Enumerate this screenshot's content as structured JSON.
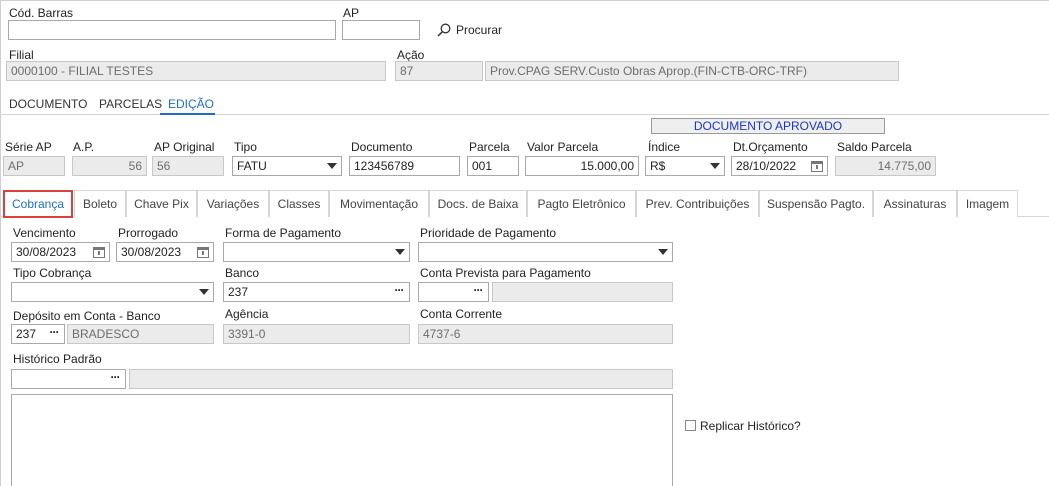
{
  "header": {
    "cod_barras_label": "Cód. Barras",
    "cod_barras_value": "",
    "ap_label": "AP",
    "ap_value": "",
    "search_label": "Procurar",
    "filial_label": "Filial",
    "filial_value": "0000100 - FILIAL TESTES",
    "acao_label": "Ação",
    "acao_code": "87",
    "acao_desc": "Prov.CPAG SERV.Custo Obras Aprop.(FIN-CTB-ORC-TRF)"
  },
  "top_tabs": [
    "DOCUMENTO",
    "PARCELAS",
    "EDIÇÃO"
  ],
  "status_badge": "DOCUMENTO APROVADO",
  "parcela": {
    "serie_ap_label": "Série AP",
    "serie_ap_value": "AP",
    "ap_num_label": "A.P.",
    "ap_num_value": "56",
    "ap_original_label": "AP Original",
    "ap_original_value": "56",
    "tipo_label": "Tipo",
    "tipo_value": "FATU",
    "documento_label": "Documento",
    "documento_value": "123456789",
    "parcela_label": "Parcela",
    "parcela_value": "001",
    "valor_label": "Valor Parcela",
    "valor_value": "15.000,00",
    "indice_label": "Índice",
    "indice_value": "R$",
    "dt_orcamento_label": "Dt.Orçamento",
    "dt_orcamento_value": "28/10/2022",
    "saldo_label": "Saldo Parcela",
    "saldo_value": "14.775,00"
  },
  "form_tabs": [
    "Cobrança",
    "Boleto",
    "Chave Pix",
    "Variações",
    "Classes",
    "Movimentação",
    "Docs. de Baixa",
    "Pagto Eletrônico",
    "Prev. Contribuições",
    "Suspensão Pagto.",
    "Assinaturas",
    "Imagem"
  ],
  "cobranca": {
    "vencimento_label": "Vencimento",
    "vencimento_value": "30/08/2023",
    "prorrogado_label": "Prorrogado",
    "prorrogado_value": "30/08/2023",
    "forma_pagamento_label": "Forma de Pagamento",
    "forma_pagamento_value": "",
    "prioridade_label": "Prioridade de Pagamento",
    "prioridade_value": "",
    "tipo_cobranca_label": "Tipo Cobrança",
    "tipo_cobranca_value": "",
    "banco_label": "Banco",
    "banco_value": "237",
    "conta_prevista_label": "Conta Prevista para Pagamento",
    "conta_prevista_value": "",
    "conta_prevista_desc": "",
    "deposito_label": "Depósito em Conta - Banco",
    "deposito_code": "237",
    "deposito_name": "BRADESCO",
    "agencia_label": "Agência",
    "agencia_value": "3391-0",
    "conta_corrente_label": "Conta Corrente",
    "conta_corrente_value": "4737-6",
    "historico_label": "Histórico Padrão",
    "historico_code": "",
    "historico_desc": "",
    "historico_text": "",
    "replicar_label": "Replicar Histórico?",
    "replicar_checked": false
  }
}
